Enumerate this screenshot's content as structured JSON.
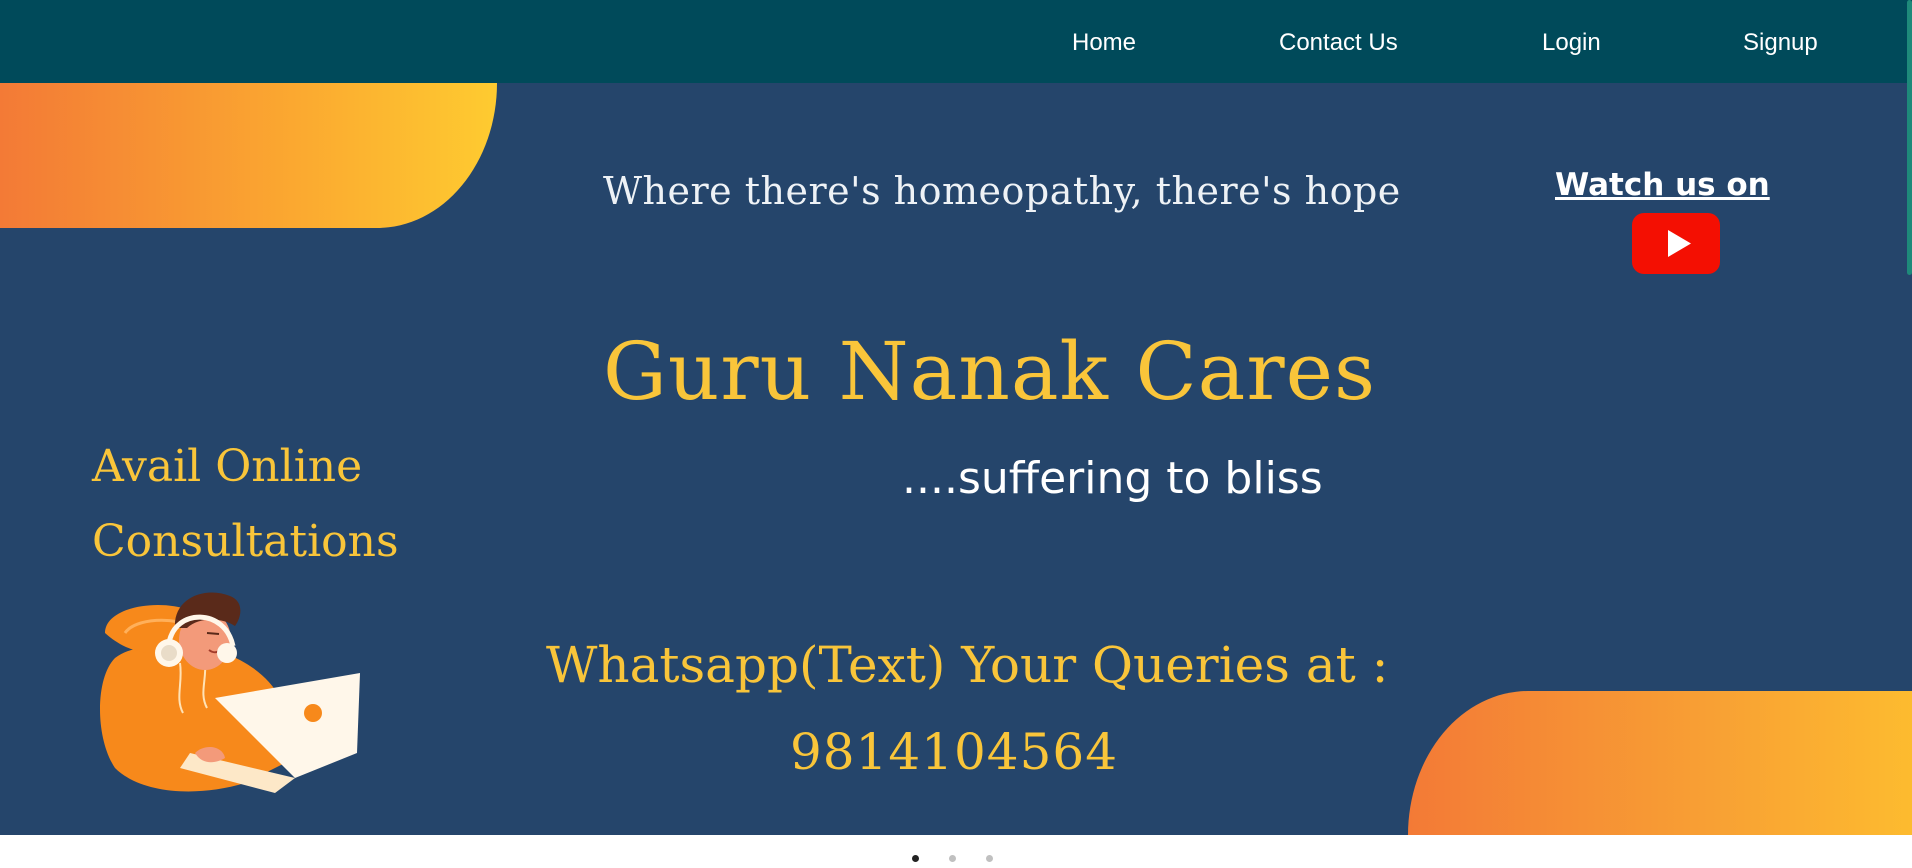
{
  "nav": {
    "links": [
      {
        "label": "Home"
      },
      {
        "label": "Contact Us"
      },
      {
        "label": "Login"
      },
      {
        "label": "Signup"
      }
    ]
  },
  "hero": {
    "tagline": "Where there's homeopathy, there's hope",
    "title": "Guru Nanak Cares",
    "subtitle": "....suffering to bliss",
    "whatsapp_text": "Whatsapp(Text) Your Queries at :",
    "whatsapp_number": "9814104564",
    "consult_line_1": "Avail Online",
    "consult_line_2": "Consultations",
    "watch_label": "Watch us on",
    "youtube_icon": "youtube-play-icon",
    "illustration": "person-with-laptop-illustration"
  },
  "carousel": {
    "dot_count": 3,
    "active_index": 0
  },
  "colors": {
    "navbar": "#004a5a",
    "hero_bg": "#25456b",
    "accent_yellow": "#f9c53a",
    "gradient_orange": "#f37a36",
    "youtube_red": "#f40f02"
  }
}
